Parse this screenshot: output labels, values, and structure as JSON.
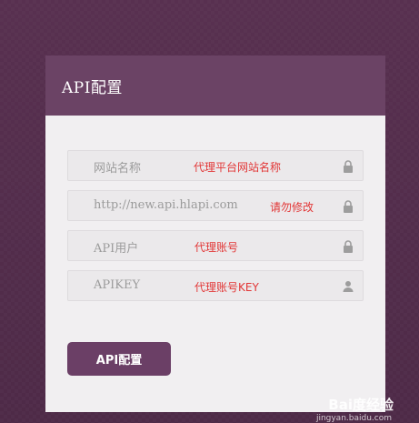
{
  "header": {
    "title": "API配置"
  },
  "fields": [
    {
      "placeholder": "网站名称",
      "note": "代理平台网站名称",
      "icon": "lock-icon"
    },
    {
      "placeholder": "http://new.api.hlapi.com",
      "note": "请勿修改",
      "icon": "lock-icon"
    },
    {
      "placeholder": "API用户",
      "note": "代理账号",
      "icon": "lock-icon"
    },
    {
      "placeholder": "APIKEY",
      "note": "代理账号KEY",
      "icon": "user-icon"
    }
  ],
  "submit_label": "API配置",
  "watermark": {
    "brand": "Bai度经验",
    "url": "jingyan.baidu.com"
  },
  "colors": {
    "header": "#6b4365",
    "button": "#6b3f66",
    "note": "#e23636",
    "background": "#583050"
  }
}
